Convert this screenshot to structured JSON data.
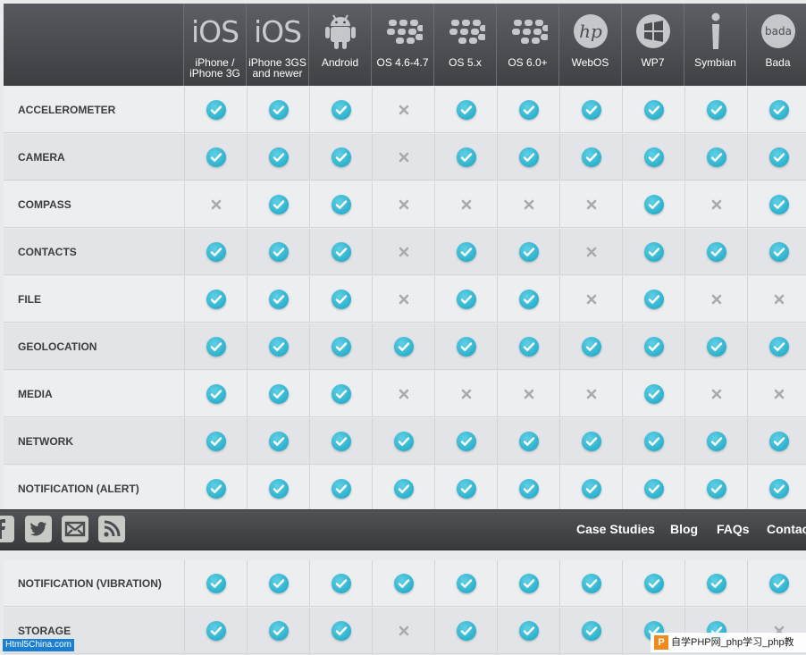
{
  "columns": [
    {
      "label": "iPhone / iPhone 3G",
      "icon": "ios-logo-icon",
      "logo_text": "iOS"
    },
    {
      "label": "iPhone 3GS and newer",
      "icon": "ios-logo-icon",
      "logo_text": "iOS"
    },
    {
      "label": "Android",
      "icon": "android-logo-icon"
    },
    {
      "label": "OS 4.6-4.7",
      "icon": "blackberry-logo-icon"
    },
    {
      "label": "OS 5.x",
      "icon": "blackberry-logo-icon"
    },
    {
      "label": "OS 6.0+",
      "icon": "blackberry-logo-icon"
    },
    {
      "label": "WebOS",
      "icon": "hp-logo-icon",
      "logo_text": "hp"
    },
    {
      "label": "WP7",
      "icon": "windows-logo-icon"
    },
    {
      "label": "Symbian",
      "icon": "symbian-logo-icon"
    },
    {
      "label": "Bada",
      "icon": "bada-logo-icon",
      "logo_text": "bada"
    }
  ],
  "features_top": [
    {
      "name": "ACCELEROMETER",
      "support": [
        1,
        1,
        1,
        0,
        1,
        1,
        1,
        1,
        1,
        1
      ]
    },
    {
      "name": "CAMERA",
      "support": [
        1,
        1,
        1,
        0,
        1,
        1,
        1,
        1,
        1,
        1
      ]
    },
    {
      "name": "COMPASS",
      "support": [
        0,
        1,
        1,
        0,
        0,
        0,
        0,
        1,
        0,
        1
      ]
    },
    {
      "name": "CONTACTS",
      "support": [
        1,
        1,
        1,
        0,
        1,
        1,
        0,
        1,
        1,
        1
      ]
    },
    {
      "name": "FILE",
      "support": [
        1,
        1,
        1,
        0,
        1,
        1,
        0,
        1,
        0,
        0
      ]
    },
    {
      "name": "GEOLOCATION",
      "support": [
        1,
        1,
        1,
        1,
        1,
        1,
        1,
        1,
        1,
        1
      ]
    },
    {
      "name": "MEDIA",
      "support": [
        1,
        1,
        1,
        0,
        0,
        0,
        0,
        1,
        0,
        0
      ]
    },
    {
      "name": "NETWORK",
      "support": [
        1,
        1,
        1,
        1,
        1,
        1,
        1,
        1,
        1,
        1
      ]
    },
    {
      "name": "NOTIFICATION (ALERT)",
      "support": [
        1,
        1,
        1,
        1,
        1,
        1,
        1,
        1,
        1,
        1
      ]
    }
  ],
  "features_bottom": [
    {
      "name": "NOTIFICATION (VIBRATION)",
      "support": [
        1,
        1,
        1,
        1,
        1,
        1,
        1,
        1,
        1,
        1
      ]
    },
    {
      "name": "STORAGE",
      "support": [
        1,
        1,
        1,
        0,
        1,
        1,
        1,
        1,
        1,
        0
      ]
    }
  ],
  "nav": {
    "social": [
      "facebook-icon",
      "twitter-icon",
      "email-icon",
      "rss-icon"
    ],
    "links": [
      "Case Studies",
      "Blog",
      "FAQs",
      "Contac"
    ]
  },
  "watermarks": {
    "left": "Html5China.com",
    "right": "自学PHP网_php学习_php教"
  },
  "colors": {
    "check": "#1ea9c7",
    "cross": "#a8aaad",
    "header_bg": "#4a4d50",
    "nav_bg": "#444649"
  }
}
